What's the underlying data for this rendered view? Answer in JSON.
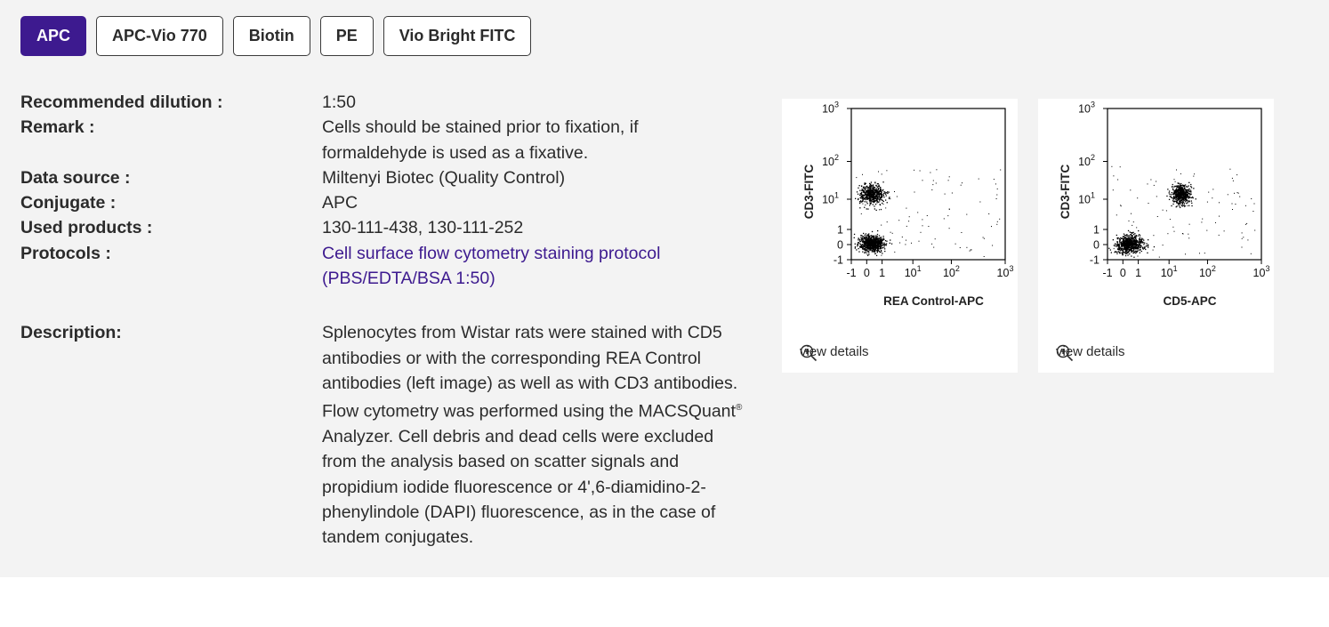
{
  "tabs": [
    {
      "label": "APC",
      "active": true
    },
    {
      "label": "APC-Vio 770",
      "active": false
    },
    {
      "label": "Biotin",
      "active": false
    },
    {
      "label": "PE",
      "active": false
    },
    {
      "label": "Vio Bright FITC",
      "active": false
    }
  ],
  "specs": {
    "dilution_label": "Recommended dilution :",
    "dilution_value": "1:50",
    "remark_label": "Remark :",
    "remark_value": "Cells should be stained prior to fixation, if formaldehyde is used as a fixative.",
    "source_label": "Data source :",
    "source_value": "Miltenyi Biotec (Quality Control)",
    "conjugate_label": "Conjugate :",
    "conjugate_value": "APC",
    "products_label": "Used products :",
    "products_value": "130-111-438, 130-111-252",
    "protocols_label": "Protocols :",
    "protocols_value": "Cell surface flow cytometry staining protocol (PBS/EDTA/BSA 1:50)",
    "description_label": "Description:",
    "description_part1": "Splenocytes from Wistar rats were stained with CD5 antibodies or with the corresponding REA Control antibodies (left image) as well as with CD3 antibodies. Flow cytometry was performed using the MACSQuant",
    "description_sup": "®",
    "description_part2": " Analyzer. Cell debris and dead cells were excluded from the analysis based on scatter signals and propidium iodide fluorescence or 4',6-diamidino-2-phenylindole (DAPI) fluorescence, as in the case of tandem conjugates."
  },
  "plots": [
    {
      "ylabel": "CD3-FITC",
      "xlabel": "REA Control-APC",
      "details_label": "view details",
      "yticks": [
        {
          "text": "-1",
          "sup": ""
        },
        {
          "text": "0",
          "sup": ""
        },
        {
          "text": "1",
          "sup": ""
        },
        {
          "text": "10",
          "sup": "1"
        },
        {
          "text": "10",
          "sup": "2"
        },
        {
          "text": "10",
          "sup": "3"
        }
      ],
      "xticks": [
        {
          "text": "-1",
          "sup": ""
        },
        {
          "text": "0",
          "sup": ""
        },
        {
          "text": "1",
          "sup": ""
        },
        {
          "text": "10",
          "sup": "1"
        },
        {
          "text": "10",
          "sup": "2"
        },
        {
          "text": "10",
          "sup": "3"
        }
      ],
      "populations": [
        {
          "x": 0.3,
          "y": 14,
          "spread_x": 0.45,
          "spread_y": 0.35,
          "count": 520
        },
        {
          "x": 0.3,
          "y": 0.1,
          "spread_x": 0.45,
          "spread_y": 0.3,
          "count": 700
        }
      ]
    },
    {
      "ylabel": "CD3-FITC",
      "xlabel": "CD5-APC",
      "details_label": "view details",
      "yticks": [
        {
          "text": "-1",
          "sup": ""
        },
        {
          "text": "0",
          "sup": ""
        },
        {
          "text": "1",
          "sup": ""
        },
        {
          "text": "10",
          "sup": "1"
        },
        {
          "text": "10",
          "sup": "2"
        },
        {
          "text": "10",
          "sup": "3"
        }
      ],
      "xticks": [
        {
          "text": "-1",
          "sup": ""
        },
        {
          "text": "0",
          "sup": ""
        },
        {
          "text": "1",
          "sup": ""
        },
        {
          "text": "10",
          "sup": "1"
        },
        {
          "text": "10",
          "sup": "2"
        },
        {
          "text": "10",
          "sup": "3"
        }
      ],
      "populations": [
        {
          "x": 0.4,
          "y": 0.05,
          "spread_x": 0.5,
          "spread_y": 0.3,
          "count": 700
        },
        {
          "x": 20,
          "y": 14,
          "spread_x": 0.35,
          "spread_y": 0.35,
          "count": 520
        }
      ]
    }
  ],
  "colors": {
    "accent": "#3d1a8f",
    "panel": "#f3f3f3"
  }
}
